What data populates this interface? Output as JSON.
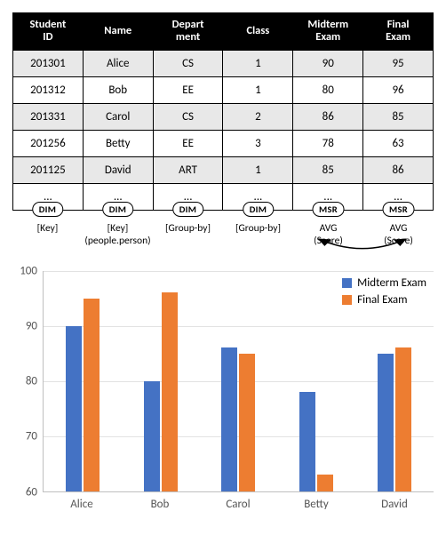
{
  "table": {
    "columns": [
      "Student ID",
      "Name",
      "Depart ment",
      "Class",
      "Midterm Exam",
      "Final Exam"
    ],
    "rows": [
      [
        "201301",
        "Alice",
        "CS",
        "1",
        "90",
        "95"
      ],
      [
        "201312",
        "Bob",
        "EE",
        "1",
        "80",
        "96"
      ],
      [
        "201331",
        "Carol",
        "CS",
        "2",
        "86",
        "85"
      ],
      [
        "201256",
        "Betty",
        "EE",
        "3",
        "78",
        "63"
      ],
      [
        "201125",
        "David",
        "ART",
        "1",
        "85",
        "86"
      ],
      [
        "...",
        "...",
        "...",
        "...",
        "...",
        "..."
      ]
    ],
    "col_tags": [
      "DIM",
      "DIM",
      "DIM",
      "DIM",
      "MSR",
      "MSR"
    ],
    "col_annotations": [
      "[Key]",
      "[Key]\n(people.person)",
      "[Group-by]",
      "[Group-by]",
      "AVG\n(Score)",
      "AVG\n(Score)"
    ]
  },
  "chart_data": {
    "type": "bar",
    "categories": [
      "Alice",
      "Bob",
      "Carol",
      "Betty",
      "David"
    ],
    "series": [
      {
        "name": "Midterm Exam",
        "color": "#4472c4",
        "values": [
          90,
          80,
          86,
          78,
          85
        ]
      },
      {
        "name": "Final Exam",
        "color": "#ed7d31",
        "values": [
          95,
          96,
          85,
          63,
          86
        ]
      }
    ],
    "xlabel": "",
    "ylabel": "",
    "ylim": [
      60,
      100
    ],
    "yticks": [
      60,
      70,
      80,
      90,
      100
    ],
    "grid": true,
    "legend_position": "top-right"
  }
}
